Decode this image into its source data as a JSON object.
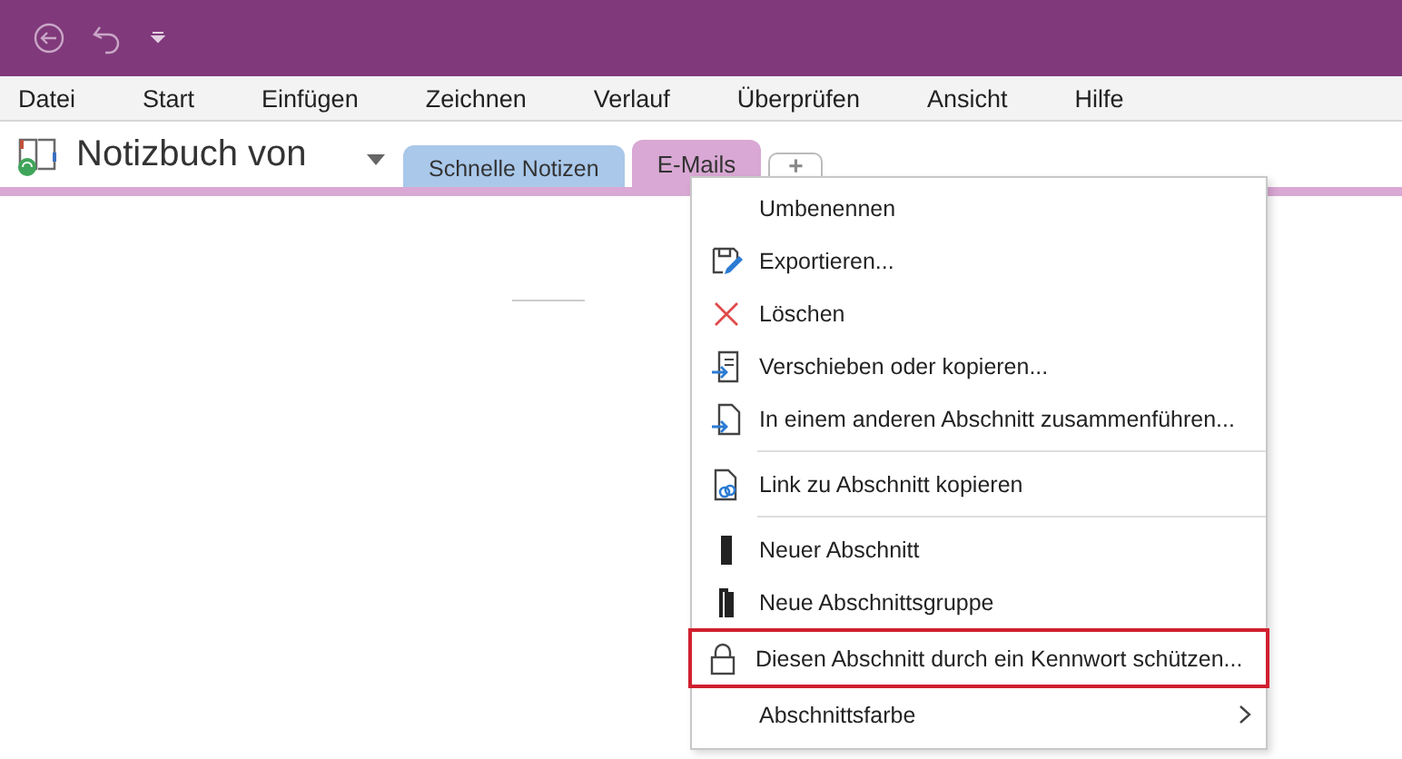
{
  "menu_bar": [
    "Datei",
    "Start",
    "Einfügen",
    "Zeichnen",
    "Verlauf",
    "Überprüfen",
    "Ansicht",
    "Hilfe"
  ],
  "notebook": {
    "title": "Notizbuch von"
  },
  "section_tabs": [
    {
      "label": "Schnelle Notizen",
      "selected": false,
      "color": "#a9c8ea"
    },
    {
      "label": "E-Mails",
      "selected": true,
      "color": "#d9a8d4"
    }
  ],
  "new_tab": "+",
  "context_menu": [
    {
      "kind": "item",
      "label": "Umbenennen",
      "highlighted": false,
      "has_submenu": false
    },
    {
      "kind": "item",
      "label": "Exportieren...",
      "highlighted": false,
      "has_submenu": false
    },
    {
      "kind": "item",
      "label": "Löschen",
      "highlighted": false,
      "has_submenu": false
    },
    {
      "kind": "item",
      "label": "Verschieben oder kopieren...",
      "highlighted": false,
      "has_submenu": false
    },
    {
      "kind": "item",
      "label": "In einem anderen Abschnitt zusammenführen...",
      "highlighted": false,
      "has_submenu": false
    },
    {
      "kind": "separator"
    },
    {
      "kind": "item",
      "label": "Link zu Abschnitt kopieren",
      "highlighted": false,
      "has_submenu": false
    },
    {
      "kind": "separator"
    },
    {
      "kind": "item",
      "label": "Neuer Abschnitt",
      "highlighted": false,
      "has_submenu": false
    },
    {
      "kind": "item",
      "label": "Neue Abschnittsgruppe",
      "highlighted": false,
      "has_submenu": false
    },
    {
      "kind": "item",
      "label": "Diesen Abschnitt durch ein Kennwort schützen...",
      "highlighted": true,
      "has_submenu": false
    },
    {
      "kind": "item",
      "label": "Abschnittsfarbe",
      "highlighted": false,
      "has_submenu": true
    }
  ]
}
